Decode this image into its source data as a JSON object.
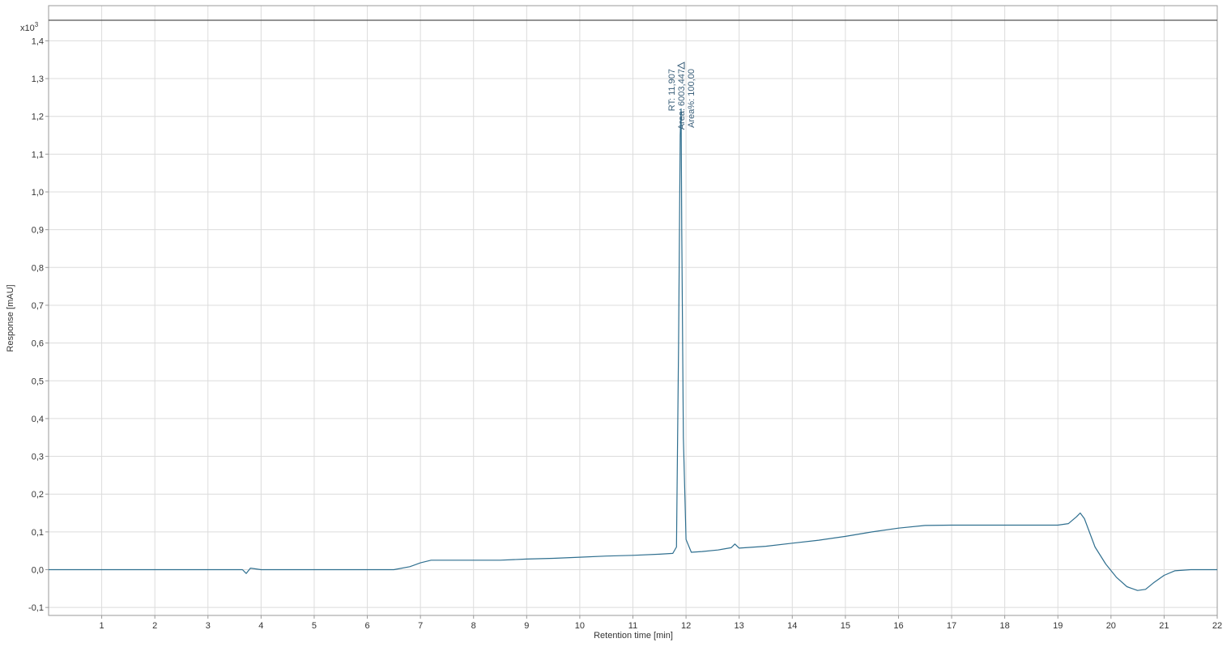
{
  "chart_data": {
    "type": "line",
    "title": "",
    "xlabel": "Retention time [min]",
    "ylabel": "Response [mAU]",
    "y_multiplier_label": "x10",
    "y_multiplier_exponent": "3",
    "xlim": [
      0,
      22
    ],
    "ylim": [
      -0.12,
      1.45
    ],
    "x_ticks": [
      1,
      2,
      3,
      4,
      5,
      6,
      7,
      8,
      9,
      10,
      11,
      12,
      13,
      14,
      15,
      16,
      17,
      18,
      19,
      20,
      21,
      22
    ],
    "y_ticks": [
      -0.1,
      0.0,
      0.1,
      0.2,
      0.3,
      0.4,
      0.5,
      0.6,
      0.7,
      0.8,
      0.9,
      1.0,
      1.1,
      1.2,
      1.3,
      1.4
    ],
    "y_tick_labels": [
      "-0,1",
      "0,0",
      "0,1",
      "0,2",
      "0,3",
      "0,4",
      "0,5",
      "0,6",
      "0,7",
      "0,8",
      "0,9",
      "1,0",
      "1,1",
      "1,2",
      "1,3",
      "1,4"
    ],
    "grid": true,
    "line_color": "#2f6f8f",
    "label_color": "#3a5f7a",
    "series": [
      {
        "x": [
          0,
          0.5,
          1,
          1.5,
          2,
          2.5,
          3,
          3.5,
          3.65,
          3.72,
          3.8,
          4,
          4.5,
          5,
          5.5,
          6,
          6.5,
          6.8,
          7,
          7.2,
          7.5,
          8,
          8.5,
          9,
          9.5,
          10,
          10.5,
          11,
          11.5,
          11.75,
          11.82,
          11.86,
          11.89,
          11.907,
          11.92,
          11.95,
          12.0,
          12.1,
          12.3,
          12.6,
          12.85,
          12.92,
          13.0,
          13.5,
          14,
          14.5,
          15,
          15.5,
          16,
          16.5,
          17,
          18,
          19,
          19.2,
          19.35,
          19.42,
          19.5,
          19.7,
          19.9,
          20.1,
          20.3,
          20.5,
          20.65,
          20.8,
          21,
          21.2,
          21.5,
          22
        ],
        "y": [
          0.0,
          0.0,
          0.0,
          0.0,
          0.0,
          0.0,
          0.0,
          0.0,
          0.0,
          -0.01,
          0.004,
          0.0,
          0.0,
          0.0,
          0.0,
          0.0,
          0.0,
          0.008,
          0.018,
          0.025,
          0.025,
          0.025,
          0.025,
          0.028,
          0.03,
          0.033,
          0.036,
          0.038,
          0.041,
          0.043,
          0.06,
          0.6,
          1.15,
          1.22,
          0.9,
          0.35,
          0.08,
          0.046,
          0.048,
          0.052,
          0.058,
          0.068,
          0.057,
          0.062,
          0.07,
          0.078,
          0.088,
          0.1,
          0.11,
          0.117,
          0.118,
          0.118,
          0.118,
          0.122,
          0.14,
          0.15,
          0.135,
          0.06,
          0.015,
          -0.02,
          -0.045,
          -0.055,
          -0.052,
          -0.035,
          -0.015,
          -0.003,
          0.0,
          0.0
        ]
      }
    ],
    "peak_annotation": {
      "lines": [
        "RT: 11,907",
        "Area: 6003,447",
        "Area%: 100,00"
      ],
      "x": 11.907,
      "y": 1.33
    }
  }
}
